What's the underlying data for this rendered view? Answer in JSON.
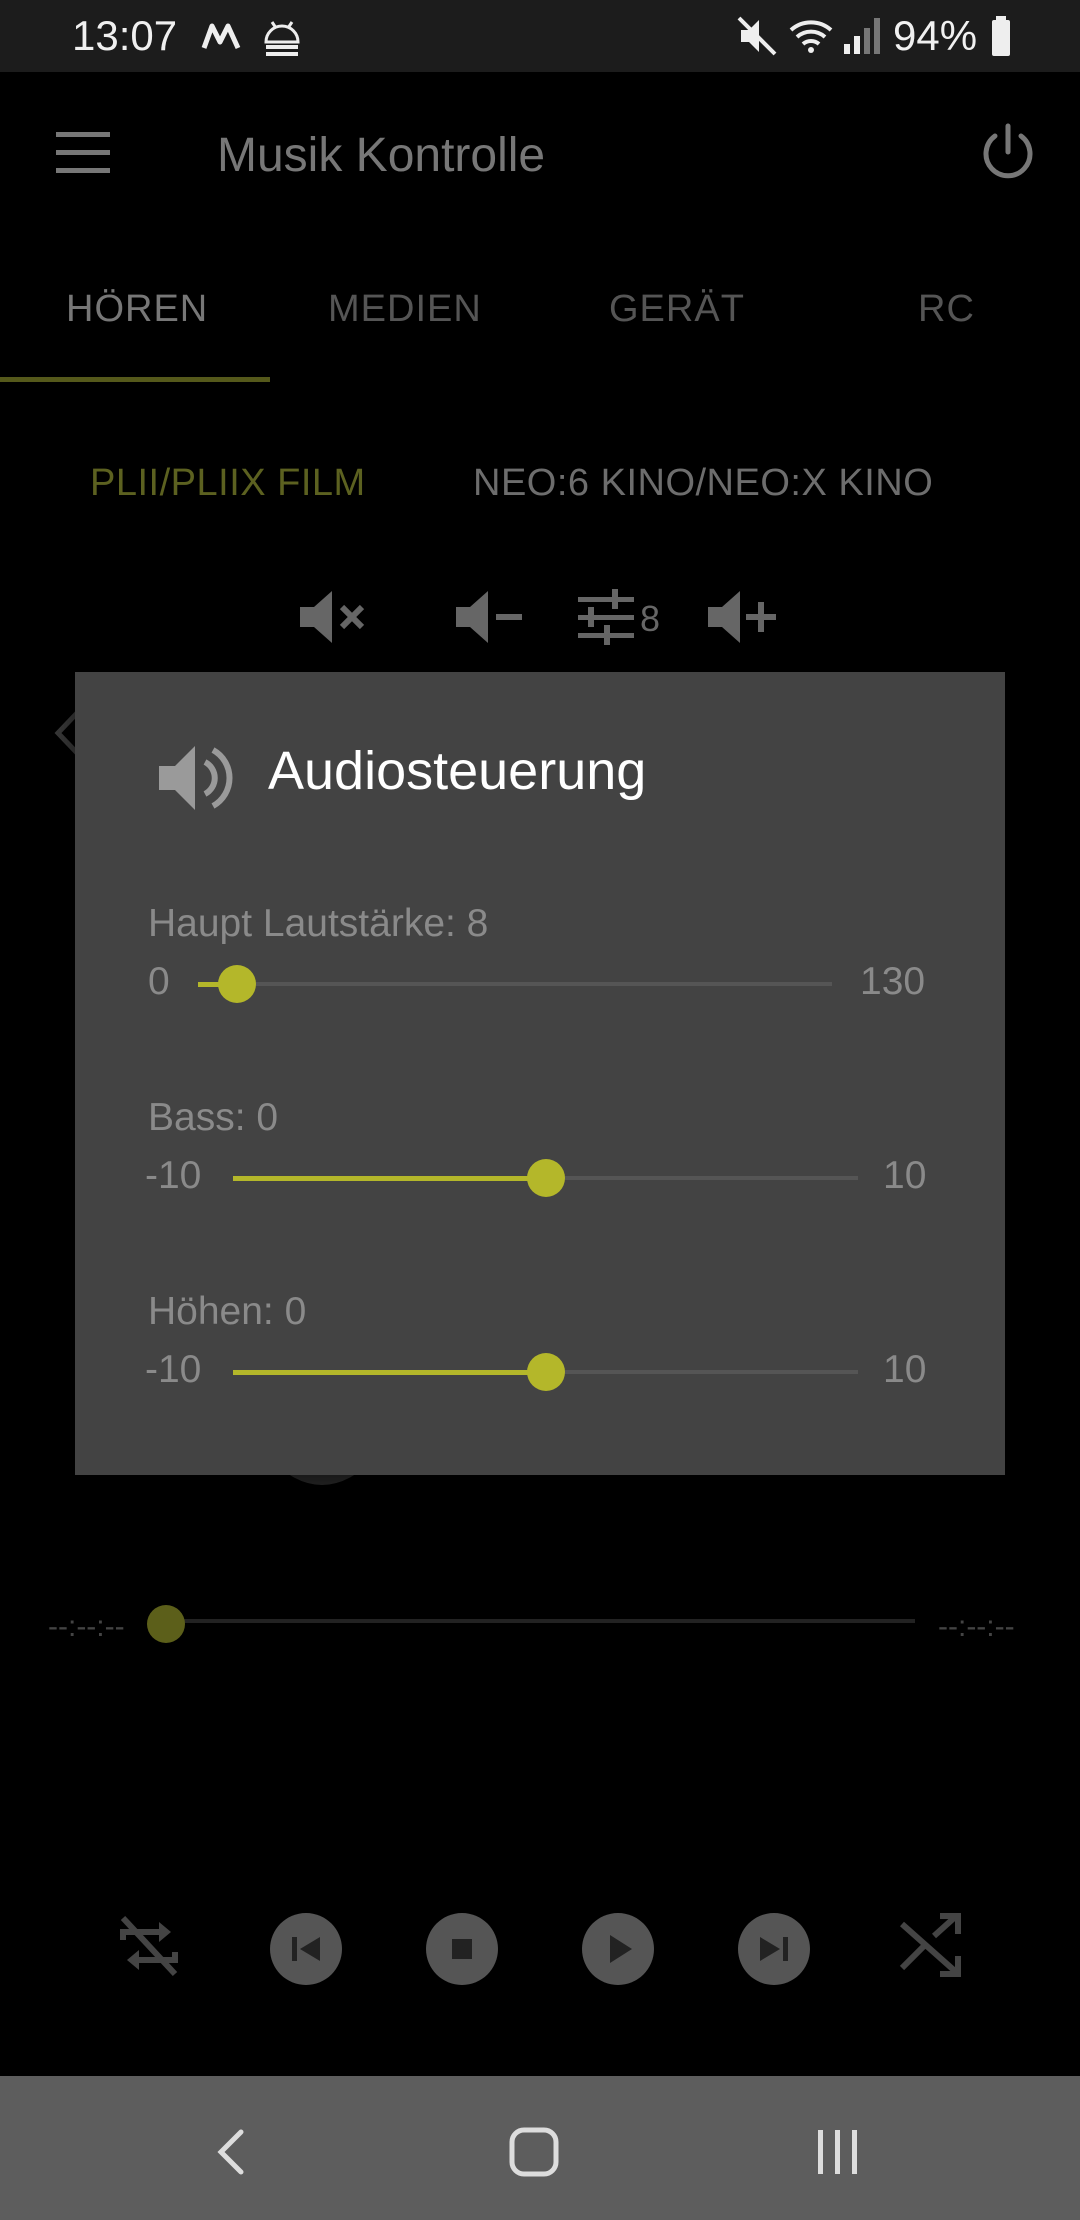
{
  "status_bar": {
    "time": "13:07",
    "battery_percent": "94%",
    "icons": [
      "m-notification-icon",
      "android-debug-icon",
      "mute-icon",
      "wifi-icon",
      "signal-icon",
      "battery-icon"
    ]
  },
  "app_bar": {
    "title": "Musik Kontrolle",
    "menu_icon": "hamburger-menu-icon",
    "power_icon": "power-icon"
  },
  "tabs": [
    {
      "label": "HÖREN",
      "active": true
    },
    {
      "label": "MEDIEN",
      "active": false
    },
    {
      "label": "GERÄT",
      "active": false
    },
    {
      "label": "RC",
      "active": false
    }
  ],
  "sound_modes": [
    {
      "label": "PLII/PLIIX FILM",
      "active": true
    },
    {
      "label": "NEO:6 KINO/NEO:X KINO",
      "active": false
    }
  ],
  "volume_toolbar": {
    "mute_icon": "volume-mute-icon",
    "down_icon": "volume-down-icon",
    "equalizer_icon": "equalizer-icon",
    "level": "8",
    "up_icon": "volume-up-icon"
  },
  "dialog": {
    "title": "Audiosteuerung",
    "icon": "speaker-icon",
    "sliders": [
      {
        "label": "Haupt Lautstärke: 8",
        "min": "0",
        "max": "130",
        "value": 8,
        "range": [
          0,
          130
        ]
      },
      {
        "label": "Bass: 0",
        "min": "-10",
        "max": "10",
        "value": 0,
        "range": [
          -10,
          10
        ]
      },
      {
        "label": "Höhen: 0",
        "min": "-10",
        "max": "10",
        "value": 0,
        "range": [
          -10,
          10
        ]
      }
    ]
  },
  "progress": {
    "elapsed": "--:--:--",
    "total": "--:--:--"
  },
  "player_controls": [
    "repeat-icon",
    "previous-icon",
    "stop-icon",
    "play-icon",
    "next-icon",
    "shuffle-icon"
  ],
  "nav_bar": [
    "back-icon",
    "home-icon",
    "recents-icon"
  ],
  "colors": {
    "accent": "#b4b72a",
    "dialog_bg": "#434343",
    "nav_bar_bg": "#5d5d5d"
  }
}
